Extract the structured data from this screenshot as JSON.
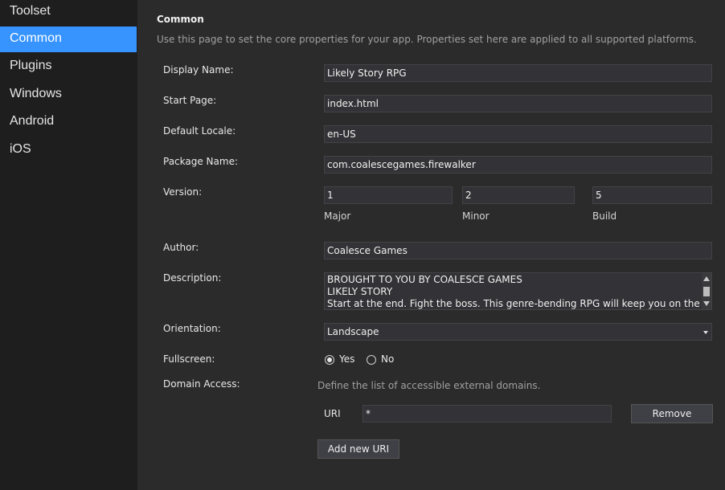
{
  "sidebar": {
    "items": [
      {
        "label": "Toolset"
      },
      {
        "label": "Common"
      },
      {
        "label": "Plugins"
      },
      {
        "label": "Windows"
      },
      {
        "label": "Android"
      },
      {
        "label": "iOS"
      }
    ],
    "active": "Common"
  },
  "page": {
    "title": "Common",
    "intro": "Use this page to set the core properties for your app. Properties set here are applied to all supported platforms."
  },
  "form": {
    "display_name": {
      "label": "Display Name:",
      "value": "Likely Story RPG"
    },
    "start_page": {
      "label": "Start Page:",
      "value": "index.html"
    },
    "default_locale": {
      "label": "Default Locale:",
      "value": "en-US"
    },
    "package_name": {
      "label": "Package Name:",
      "value": "com.coalescegames.firewalker"
    },
    "version": {
      "label": "Version:",
      "major": {
        "value": "1",
        "label": "Major"
      },
      "minor": {
        "value": "2",
        "label": "Minor"
      },
      "build": {
        "value": "5",
        "label": "Build"
      }
    },
    "author": {
      "label": "Author:",
      "value": "Coalesce Games"
    },
    "description": {
      "label": "Description:",
      "lines": [
        "BROUGHT TO YOU BY COALESCE GAMES",
        "LIKELY STORY",
        "Start at the end. Fight the boss. This genre-bending RPG will keep you on the edge of"
      ]
    },
    "orientation": {
      "label": "Orientation:",
      "value": "Landscape"
    },
    "fullscreen": {
      "label": "Fullscreen:",
      "yes": "Yes",
      "no": "No",
      "selected": "Yes"
    },
    "domain_access": {
      "label": "Domain Access:",
      "hint": "Define the list of accessible external domains.",
      "uri_label": "URI",
      "uri_value": "*",
      "remove_label": "Remove",
      "add_label": "Add new URI"
    }
  },
  "colors": {
    "accent": "#3794ff",
    "sidebar_bg": "#1e1e1e",
    "main_bg": "#2b2b2b",
    "field_bg": "#333337"
  }
}
